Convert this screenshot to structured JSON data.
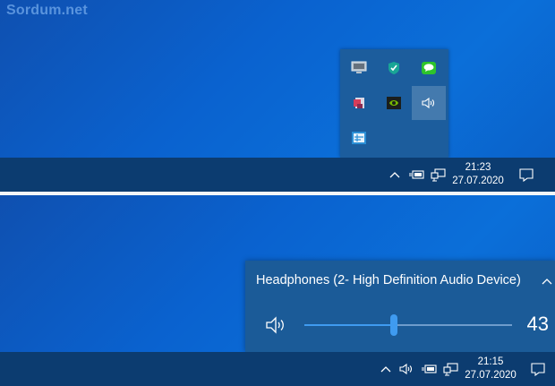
{
  "watermark": "Sordum.net",
  "top": {
    "flyout_icons": [
      "monitor-icon",
      "shield-check-icon",
      "chat-bubble-icon",
      "app-puzzle-icon",
      "nvidia-icon",
      "speaker-icon",
      "network-manager-icon"
    ],
    "tray_icons": [
      "chevron-up-icon",
      "power-icon",
      "network-icon"
    ],
    "clock": {
      "time": "21:23",
      "date": "27.07.2020"
    }
  },
  "bottom": {
    "volume": {
      "device": "Headphones (2- High Definition Audio Device)",
      "level": 43
    },
    "tray_icons": [
      "chevron-up-icon",
      "speaker-icon",
      "power-icon",
      "network-icon"
    ],
    "clock": {
      "time": "21:15",
      "date": "27.07.2020"
    }
  },
  "colors": {
    "taskbar": "#0c3c70",
    "flyout": "#1c5d9d",
    "accent": "#3f9bf0",
    "desktop": "#0b63c9"
  }
}
